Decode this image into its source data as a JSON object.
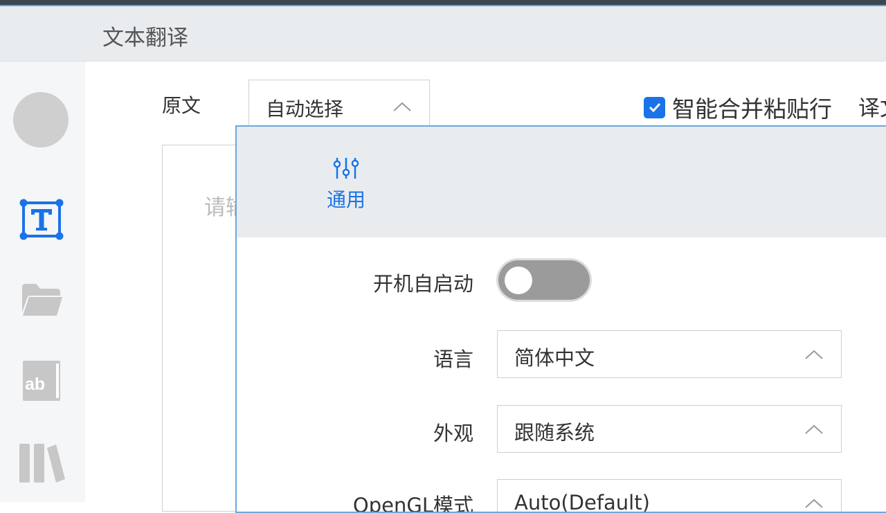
{
  "window": {
    "title": "文本翻译"
  },
  "sidebar": {
    "items": [
      {
        "icon": "text-icon",
        "active": true
      },
      {
        "icon": "folder-icon",
        "active": false
      },
      {
        "icon": "ab-book-icon",
        "active": false
      },
      {
        "icon": "library-icon",
        "active": false
      }
    ]
  },
  "main": {
    "source_label": "原文",
    "source_language": "自动选择",
    "merge_checkbox": {
      "checked": true,
      "label": "智能合并粘贴行"
    },
    "target_label": "译文",
    "input_placeholder": "请输"
  },
  "settings_panel": {
    "tab": {
      "icon": "sliders-icon",
      "label": "通用"
    },
    "rows": {
      "autostart": {
        "label": "开机自启动",
        "value": false
      },
      "language": {
        "label": "语言",
        "value": "简体中文"
      },
      "appearance": {
        "label": "外观",
        "value": "跟随系统"
      },
      "opengl": {
        "label": "OpenGL模式",
        "value": "Auto(Default)"
      }
    }
  },
  "colors": {
    "accent": "#1a73e8",
    "titlebar_bg": "#e9ecef",
    "panel_border": "#6aa8dd"
  }
}
